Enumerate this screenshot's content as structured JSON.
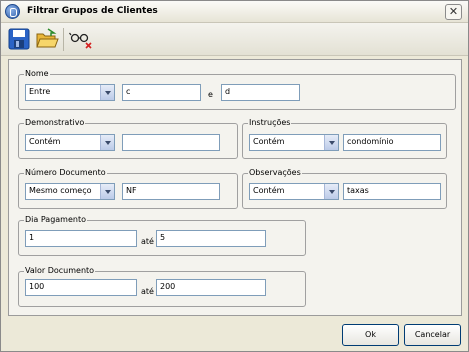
{
  "window": {
    "title": "Filtrar Grupos de Clientes"
  },
  "groups": {
    "nome": {
      "label": "Nome",
      "operator": "Entre",
      "value_from": "c",
      "connector": "e",
      "value_to": "d"
    },
    "demonstrativo": {
      "label": "Demonstrativo",
      "operator": "Contém",
      "value": ""
    },
    "instrucoes": {
      "label": "Instruções",
      "operator": "Contém",
      "value": "condomínio"
    },
    "numero_documento": {
      "label": "Número Documento",
      "operator": "Mesmo começo",
      "value": "NF"
    },
    "observacoes": {
      "label": "Observações",
      "operator": "Contém",
      "value": "taxas"
    },
    "dia_pagamento": {
      "label": "Dia Pagamento",
      "value_from": "1",
      "connector": "até",
      "value_to": "5"
    },
    "valor_documento": {
      "label": "Valor Documento",
      "value_from": "100",
      "connector": "até",
      "value_to": "200"
    }
  },
  "buttons": {
    "ok": "Ok",
    "cancel": "Cancelar"
  },
  "icons": {
    "app": "app-logo-icon",
    "save": "save-icon",
    "open": "open-folder-icon",
    "clear": "clear-filter-icon",
    "close": "close-icon"
  }
}
